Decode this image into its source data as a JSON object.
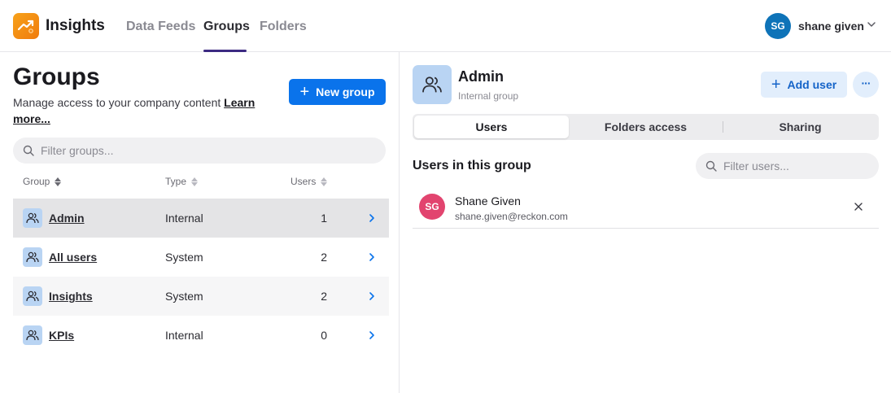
{
  "app": {
    "title": "Insights",
    "accent": "#f39317"
  },
  "nav": {
    "tabs": [
      {
        "label": "Data Feeds"
      },
      {
        "label": "Groups",
        "active": true
      },
      {
        "label": "Folders"
      }
    ]
  },
  "user": {
    "initials": "SG",
    "name": "shane given",
    "avatar_color": "#0e73b8"
  },
  "left": {
    "title": "Groups",
    "subtitle": "Manage access to your company content ",
    "learn_more": "Learn more...",
    "new_group_label": "New group",
    "filter_placeholder": "Filter groups...",
    "columns": [
      "Group",
      "Type",
      "Users"
    ],
    "rows": [
      {
        "name": "Admin",
        "type": "Internal",
        "users": "1",
        "selected": true
      },
      {
        "name": "All users",
        "type": "System",
        "users": "2"
      },
      {
        "name": "Insights",
        "type": "System",
        "users": "2"
      },
      {
        "name": "KPIs",
        "type": "Internal",
        "users": "0"
      }
    ]
  },
  "right": {
    "group_name": "Admin",
    "group_type": "Internal group",
    "add_user_label": "Add user",
    "more_label": "···",
    "tabs": [
      {
        "label": "Users",
        "active": true
      },
      {
        "label": "Folders access"
      },
      {
        "label": "Sharing"
      }
    ],
    "section_title": "Users in this group",
    "filter_placeholder": "Filter users...",
    "members": [
      {
        "initials": "SG",
        "name": "Shane Given",
        "email": "shane.given@reckon.com",
        "avatar_color": "#e2446f"
      }
    ]
  }
}
